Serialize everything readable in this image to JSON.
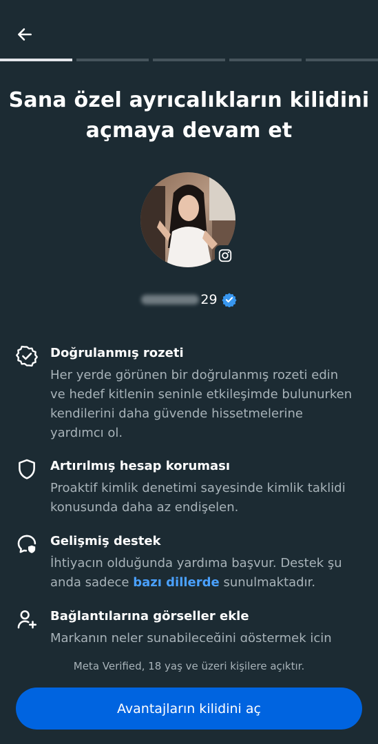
{
  "header": {
    "back_icon": "arrow-left-icon",
    "progress_total": 5,
    "progress_current": 1
  },
  "title": "Sana özel ayrıcalıkların kilidini açmaya devam et",
  "profile": {
    "platform_icon": "instagram-icon",
    "username_visible": "29",
    "verified_icon": "verified-badge-icon",
    "verified_color": "#3897f0"
  },
  "features": [
    {
      "icon": "verified-badge-outline-icon",
      "title": "Doğrulanmış rozeti",
      "description": "Her yerde görünen bir doğrulanmış rozeti edin ve hedef kitlenin seninle etkileşimde bulunurken kendilerini daha güvende hissetmelerine yardımcı ol."
    },
    {
      "icon": "shield-icon",
      "title": "Artırılmış hesap koruması",
      "description": "Proaktif kimlik denetimi sayesinde kimlik taklidi konusunda daha az endişelen."
    },
    {
      "icon": "support-chat-icon",
      "title": "Gelişmiş destek",
      "description_before": "İhtiyacın olduğunda yardıma başvur. Destek şu anda sadece ",
      "description_link": "bazı dillerde",
      "description_after": " sunulmaktadır."
    },
    {
      "icon": "person-add-icon",
      "title": "Bağlantılarına görseller ekle",
      "description": "Markanın neler sunabileceğini göstermek için"
    }
  ],
  "footer": {
    "note": "Meta Verified, 18 yaş ve üzeri kişilere açıktır.",
    "cta_label": "Avantajların kilidini aç"
  },
  "colors": {
    "background": "#1c2b33",
    "primary": "#0064e0",
    "link": "#4aa1ff",
    "secondary_text": "#a8b3b9"
  }
}
